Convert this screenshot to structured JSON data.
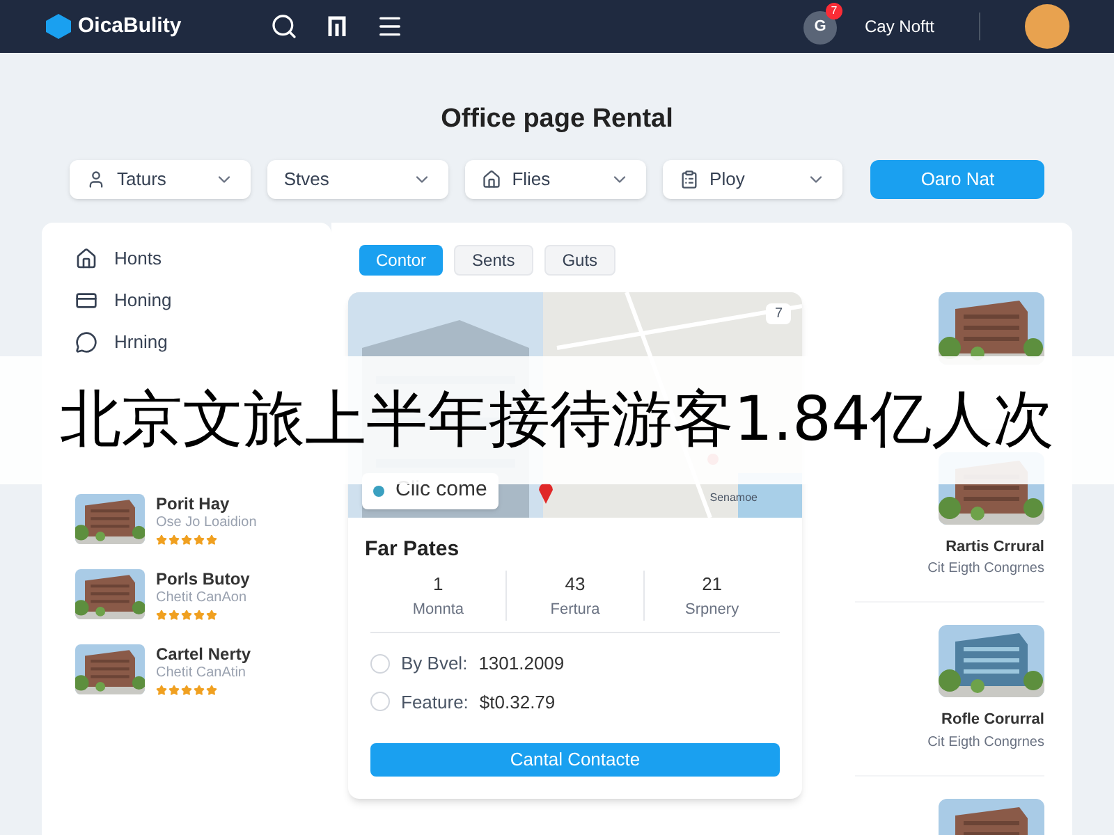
{
  "header": {
    "brand": "OicaBulity",
    "notification_badge": "7",
    "notification_letter": "G",
    "user_name": "Cay Noftt"
  },
  "title": "Office page Rental",
  "filters": [
    {
      "kind": "person",
      "label": "Taturs"
    },
    {
      "kind": "plain",
      "label": "Stves"
    },
    {
      "kind": "home",
      "label": "Flies"
    },
    {
      "kind": "clipboard",
      "label": "Ploy"
    }
  ],
  "search_button": "Oaro Nat",
  "sidebar": {
    "items": [
      {
        "kind": "home",
        "label": "Honts"
      },
      {
        "kind": "card",
        "label": "Honing"
      },
      {
        "kind": "chat",
        "label": "Hrning"
      }
    ],
    "listings": [
      {
        "name": "Porit Hay",
        "location": "Ose Jo Loaidion",
        "stars": 5
      },
      {
        "name": "Porls Butoy",
        "location": "Chetit CanAon",
        "stars": 5
      },
      {
        "name": "Cartel Nerty",
        "location": "Chetit CanAtin",
        "stars": 5
      }
    ]
  },
  "tabs": [
    {
      "label": "Contor",
      "selected": true
    },
    {
      "label": "Sents",
      "selected": false
    },
    {
      "label": "Guts",
      "selected": false
    }
  ],
  "detail": {
    "map_badge": "7",
    "map_chip": "Clic come",
    "map_label": "Senamoe",
    "heading": "Far Pates",
    "stats": [
      {
        "value": "1",
        "label": "Monnta"
      },
      {
        "value": "43",
        "label": "Fertura"
      },
      {
        "value": "21",
        "label": "Srpnery"
      }
    ],
    "options": [
      {
        "label": "By Bvel:",
        "value": "1301.2009",
        "checked": false
      },
      {
        "label": "Feature:",
        "value": "$t0.32.79",
        "checked": false
      }
    ],
    "button": "Cantal Contacte"
  },
  "right_list": [
    {
      "kind": "picture"
    },
    {
      "kind": "listing",
      "name": "Rartis Crrural",
      "location": "Cit Eigth Congrnes"
    },
    {
      "kind": "listing",
      "name": "Rofle Corurral",
      "location": "Cit Eigth Congrnes"
    },
    {
      "kind": "picture"
    }
  ],
  "banner": "北京文旅上半年接待游客1.84亿人次"
}
